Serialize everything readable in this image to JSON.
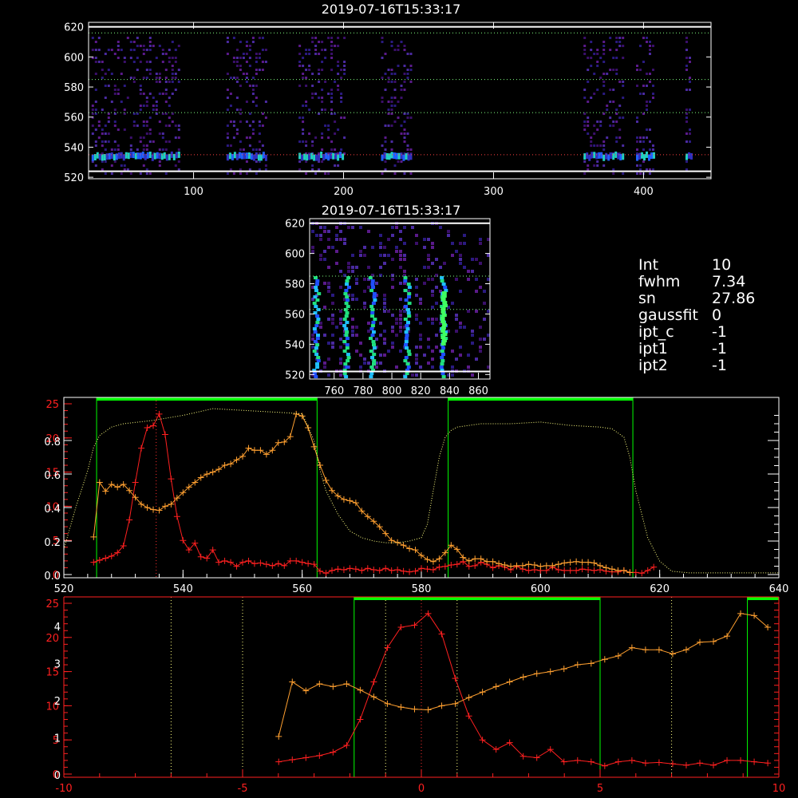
{
  "panel_top": {
    "title": "2019-07-16T15:33:17",
    "x_ticks": [
      100,
      200,
      300,
      400
    ],
    "y_ticks": [
      520,
      540,
      560,
      580,
      600,
      620
    ],
    "x_range": [
      30,
      445
    ],
    "y_range": [
      519,
      623
    ]
  },
  "panel_mid": {
    "title": "2019-07-16T15:33:17",
    "x_ticks": [
      760,
      780,
      800,
      820,
      840,
      860
    ],
    "y_ticks": [
      520,
      540,
      560,
      580,
      600,
      620
    ],
    "x_range": [
      743,
      868
    ],
    "y_range": [
      517,
      623
    ]
  },
  "params": [
    {
      "key": "Int",
      "value": "10"
    },
    {
      "key": "fwhm",
      "value": "7.34"
    },
    {
      "key": "sn",
      "value": "27.86"
    },
    {
      "key": "gaussfit",
      "value": "0"
    },
    {
      "key": "ipt_c",
      "value": "-1"
    },
    {
      "key": "ipt1",
      "value": "-1"
    },
    {
      "key": "ipt2",
      "value": "-1"
    }
  ],
  "colors": {
    "axis": "#ffffff",
    "red_series": "#ff2020",
    "orange_series": "#ffa030",
    "green": "#00ff00",
    "yellow_dotted": "#ffff80",
    "red_axis": "#ff2020"
  },
  "chart_data": [
    {
      "type": "heatmap",
      "title": "2019-07-16T15:33:17",
      "xlim": [
        30,
        445
      ],
      "ylim": [
        519,
        623
      ],
      "bands_x": [
        [
          32,
          90
        ],
        [
          122,
          148
        ],
        [
          170,
          200
        ],
        [
          225,
          245
        ],
        [
          360,
          387
        ],
        [
          395,
          407
        ],
        [
          428,
          432
        ]
      ],
      "bright_row_y": 535,
      "h_lines": [
        535,
        563,
        585,
        616
      ]
    },
    {
      "type": "heatmap",
      "title": "2019-07-16T15:33:17",
      "xlim": [
        743,
        868
      ],
      "ylim": [
        517,
        623
      ],
      "bright_columns_x": [
        747,
        768,
        786,
        810,
        835
      ],
      "h_lines": [
        563,
        585
      ]
    },
    {
      "type": "line",
      "xlim": [
        520,
        640
      ],
      "x_ticks": [
        520,
        540,
        560,
        580,
        600,
        620,
        640
      ],
      "y_left_ticks_red": [
        0,
        5,
        10,
        15,
        20,
        25
      ],
      "y_left_ticks_white": [
        0.0,
        0.2,
        0.4,
        0.6,
        0.8
      ],
      "green_windows": [
        [
          525.5,
          562.5
        ],
        [
          584.5,
          615.5
        ]
      ],
      "vline": 535.5,
      "series": [
        {
          "color": "red",
          "x": [
            525,
            526,
            527,
            528,
            529,
            530,
            531,
            532,
            533,
            534,
            535,
            536,
            537,
            538,
            539,
            540,
            541,
            542,
            543,
            544,
            545,
            546,
            547,
            548,
            549,
            550,
            551,
            552,
            553,
            554,
            555,
            556,
            557,
            558,
            559,
            560,
            561,
            562,
            563,
            564,
            565,
            566,
            567,
            568,
            569,
            570,
            571,
            572,
            573,
            574,
            575,
            576,
            577,
            578,
            579,
            580,
            581,
            582,
            583,
            584,
            585,
            586,
            587,
            588,
            589,
            590,
            591,
            592,
            593,
            594,
            595,
            596,
            597,
            598,
            599,
            600,
            601,
            602,
            603,
            604,
            605,
            606,
            607,
            608,
            609,
            610,
            611,
            612,
            613,
            614,
            615,
            616,
            617,
            618,
            619
          ],
          "values": [
            1.8,
            2.1,
            2.4,
            2.7,
            3.2,
            4.2,
            8.0,
            13.5,
            18.5,
            21.5,
            21.8,
            23.5,
            20.5,
            14.0,
            8.5,
            5.0,
            3.6,
            4.6,
            2.6,
            2.4,
            3.6,
            1.8,
            2.0,
            1.8,
            1.2,
            1.8,
            2.0,
            1.6,
            1.7,
            1.5,
            1.3,
            1.6,
            1.3,
            2.0,
            2.0,
            1.8,
            1.6,
            1.5,
            0.5,
            0.2,
            0.6,
            0.8,
            0.7,
            0.9,
            0.8,
            0.6,
            0.9,
            0.7,
            0.6,
            0.9,
            0.6,
            0.7,
            0.5,
            0.4,
            0.5,
            0.9,
            0.8,
            0.7,
            1.1,
            1.2,
            1.4,
            1.5,
            1.9,
            1.2,
            1.3,
            1.8,
            1.5,
            1.0,
            1.3,
            1.1,
            0.7,
            1.2,
            0.8,
            0.6,
            0.7,
            0.6,
            0.6,
            1.1,
            0.7,
            0.6,
            0.6,
            0.6,
            0.8,
            0.7,
            0.6,
            0.7,
            0.5,
            0.4,
            0.4,
            0.6,
            0.3,
            0.3,
            0.2,
            0.6,
            1.1
          ]
        },
        {
          "color": "orange",
          "x": [
            525,
            526,
            527,
            528,
            529,
            530,
            531,
            532,
            533,
            534,
            535,
            536,
            537,
            538,
            539,
            540,
            541,
            542,
            543,
            544,
            545,
            546,
            547,
            548,
            549,
            550,
            551,
            552,
            553,
            554,
            555,
            556,
            557,
            558,
            559,
            560,
            561,
            562,
            563,
            564,
            565,
            566,
            567,
            568,
            569,
            570,
            571,
            572,
            573,
            574,
            575,
            576,
            577,
            578,
            579,
            580,
            581,
            582,
            583,
            584,
            585,
            586,
            587,
            588,
            589,
            590,
            591,
            592,
            593,
            594,
            595,
            596,
            597,
            598,
            599,
            600,
            601,
            602,
            603,
            604,
            605,
            606,
            607,
            608,
            609,
            610,
            611,
            612,
            613,
            614,
            615
          ],
          "values": [
            5.5,
            13.5,
            12.2,
            13.2,
            12.8,
            13.2,
            12.3,
            11.3,
            10.3,
            9.8,
            9.5,
            9.4,
            10.0,
            10.3,
            11.2,
            12.0,
            12.8,
            13.5,
            14.2,
            14.7,
            15.0,
            15.4,
            16.0,
            16.2,
            16.8,
            17.3,
            18.5,
            18.2,
            18.2,
            17.6,
            18.2,
            19.3,
            19.4,
            20.2,
            23.5,
            23.2,
            21.5,
            18.7,
            16.0,
            13.8,
            12.3,
            11.5,
            11.0,
            10.8,
            10.5,
            9.3,
            8.5,
            7.8,
            7.0,
            6.0,
            5.0,
            4.7,
            4.3,
            3.8,
            3.6,
            2.8,
            2.2,
            1.9,
            2.3,
            3.2,
            4.3,
            3.7,
            2.5,
            2.0,
            2.3,
            2.3,
            1.9,
            1.9,
            1.6,
            1.4,
            1.2,
            1.3,
            1.3,
            1.5,
            1.4,
            1.2,
            1.3,
            1.3,
            1.5,
            1.7,
            1.8,
            1.9,
            1.8,
            1.8,
            1.7,
            1.3,
            1.0,
            0.8,
            0.6,
            0.6,
            0.3
          ]
        },
        {
          "color": "yellow-dotted",
          "x": [
            520,
            522,
            524,
            525,
            526,
            528,
            530,
            535,
            540,
            545,
            550,
            555,
            560,
            562,
            563,
            564,
            566,
            568,
            570,
            572,
            574,
            576,
            578,
            580,
            581,
            582,
            583,
            584,
            585,
            586,
            588,
            590,
            595,
            600,
            605,
            610,
            612,
            614,
            615,
            616,
            618,
            620,
            622,
            625,
            630,
            635,
            640
          ],
          "values": [
            0.15,
            0.4,
            0.62,
            0.76,
            0.83,
            0.88,
            0.9,
            0.92,
            0.95,
            0.99,
            0.98,
            0.97,
            0.96,
            0.8,
            0.62,
            0.5,
            0.36,
            0.26,
            0.22,
            0.2,
            0.19,
            0.19,
            0.2,
            0.22,
            0.3,
            0.5,
            0.7,
            0.82,
            0.86,
            0.88,
            0.89,
            0.9,
            0.9,
            0.91,
            0.89,
            0.88,
            0.87,
            0.82,
            0.7,
            0.5,
            0.22,
            0.08,
            0.02,
            0.01,
            0.01,
            0.01,
            0.01
          ]
        }
      ]
    },
    {
      "type": "line",
      "xlim": [
        -10,
        10
      ],
      "x_ticks": [
        -10,
        -5,
        0,
        5,
        10
      ],
      "y_left_ticks_red": [
        0,
        5,
        10,
        15,
        20,
        25
      ],
      "y_left_ticks_white": [
        0,
        1,
        2,
        3,
        4
      ],
      "green_windows": [
        [
          -1.88,
          5.0
        ],
        [
          9.12,
          10
        ]
      ],
      "vlines_dotted": [
        -7,
        -5,
        -1,
        0,
        1,
        7
      ]
    }
  ]
}
